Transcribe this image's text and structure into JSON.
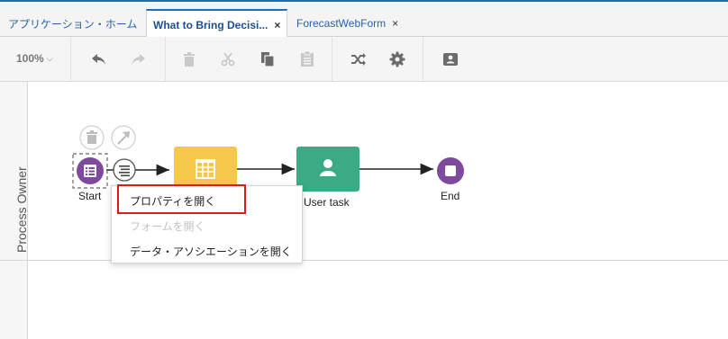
{
  "tabs": [
    {
      "label": "アプリケーション・ホーム",
      "active": false
    },
    {
      "label": "What to Bring Decisi...",
      "active": true,
      "close": "×"
    },
    {
      "label": "ForecastWebForm",
      "active": false,
      "close": "×"
    }
  ],
  "toolbar": {
    "zoom": "100%",
    "icons": [
      "undo-icon",
      "redo-icon",
      "delete-icon",
      "cut-icon",
      "copy-icon",
      "paste-icon",
      "shuffle-icon",
      "gear-icon",
      "contact-card-icon"
    ]
  },
  "lane": {
    "label": "Process Owner"
  },
  "nodes": {
    "start": {
      "label": "Start",
      "color": "#7e4a9e"
    },
    "decision": {
      "label": "",
      "color": "#f5c84b"
    },
    "user_task": {
      "label": "User task",
      "color": "#3aab84"
    },
    "end": {
      "label": "End",
      "color": "#7e4a9e"
    }
  },
  "context_menu": {
    "items": [
      {
        "label": "プロパティを開く",
        "enabled": true
      },
      {
        "label": "フォームを開く",
        "enabled": false
      },
      {
        "label": "データ・アソシエーションを開く",
        "enabled": true
      }
    ]
  },
  "colors": {
    "accent": "#1f6fb0",
    "highlight_border": "#e01919"
  }
}
